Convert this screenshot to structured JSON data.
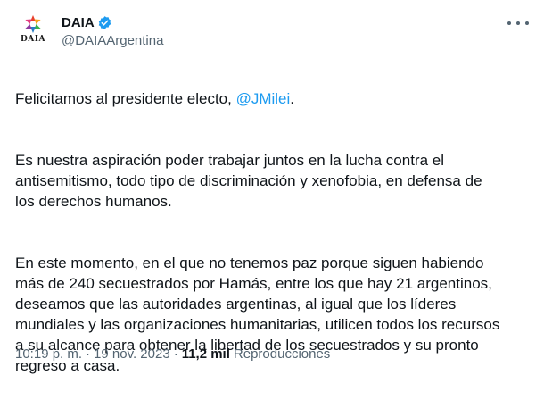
{
  "account": {
    "display_name": "DAIA",
    "handle": "@DAIAArgentina",
    "avatar_text": "DAIA",
    "verified_color": "#1d9bf0"
  },
  "tweet": {
    "p1_before": "Felicitamos al presidente electo, ",
    "p1_mention": "@JMilei",
    "p1_after": ".",
    "p2": "Es nuestra aspiración poder trabajar juntos en la lucha contra el\nantisemitismo, todo tipo de discriminación y xenofobia, en defensa de\nlos derechos humanos.",
    "p3": "En este momento, en el que no tenemos paz porque siguen habiendo\nmás de 240 secuestrados por Hamás, entre los que hay 21 argentinos,\ndeseamos que las autoridades argentinas, al igual que los líderes\nmundiales y las organizaciones humanitarias, utilicen todos los recursos\na su alcance para obtener la libertad de los secuestrados y su pronto\nregreso a casa."
  },
  "meta": {
    "time": "10:19 p. m.",
    "separator": "·",
    "date": "19 nov. 2023",
    "views_count": "11,2 mil",
    "views_label": "Reproducciones"
  },
  "icons": {
    "more": "more-icon",
    "verified": "verified-badge-icon",
    "logo": "daia-star-logo"
  },
  "colors": {
    "text": "#0f1419",
    "secondary": "#536471",
    "link": "#1d9bf0"
  }
}
